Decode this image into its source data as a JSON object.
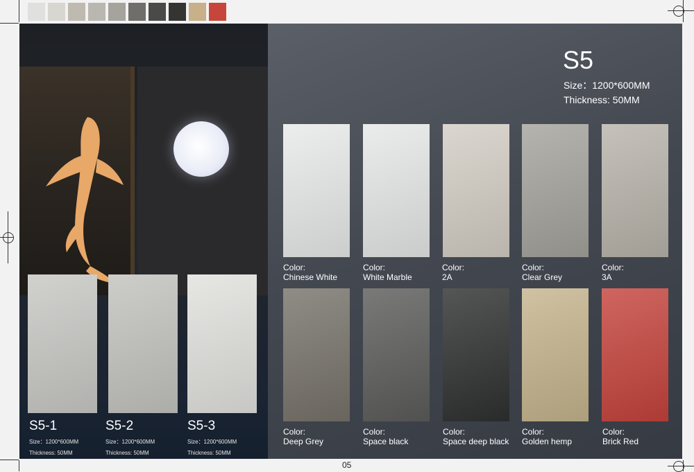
{
  "color_strip": [
    "#e0e0de",
    "#d8d6d0",
    "#bfbab0",
    "#b9b7b0",
    "#a6a39c",
    "#6f6e6a",
    "#4a4a48",
    "#343533",
    "#c7b08a",
    "#c8453c"
  ],
  "series": {
    "title": "S5",
    "size": "Size：1200*600MM",
    "thickness": "Thickness: 50MM"
  },
  "color_caption": "Color:",
  "left_samples": [
    {
      "code": "S5-1",
      "size": "Size：1200*600MM",
      "thickness": "Thickness: 50MM",
      "color": "#c9c9c6"
    },
    {
      "code": "S5-2",
      "size": "Size：1200*600MM",
      "thickness": "Thickness: 50MM",
      "color": "#c4c4c0"
    },
    {
      "code": "S5-3",
      "size": "Size：1200*600MM",
      "thickness": "Thickness: 50MM",
      "color": "#e2e2df"
    }
  ],
  "tiles": [
    {
      "name": "Chinese White",
      "color": "#e8eae9"
    },
    {
      "name": "White Marble",
      "color": "#e6e8e7"
    },
    {
      "name": "2A",
      "color": "#d3cdc4"
    },
    {
      "name": "Clear Grey",
      "color": "#a4a39c"
    },
    {
      "name": "3A",
      "color": "#b8b4ab"
    },
    {
      "name": "Deep Grey",
      "color": "#77736b"
    },
    {
      "name": "Space black",
      "color": "#5c5c5b"
    },
    {
      "name": "Space deep black",
      "color": "#2f3030"
    },
    {
      "name": "Golden hemp",
      "color": "#c5b48d"
    },
    {
      "name": "Brick Red",
      "color": "#c5433c"
    }
  ],
  "page_number": "05"
}
